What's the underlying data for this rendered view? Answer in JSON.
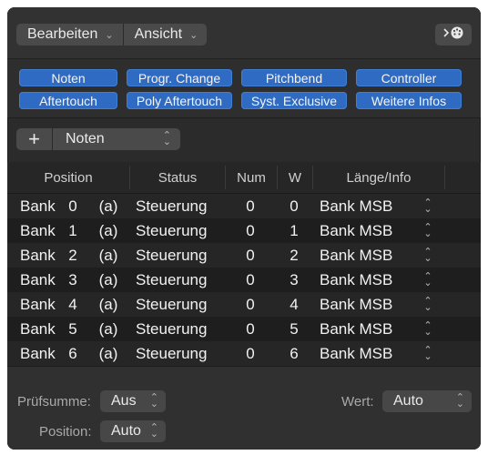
{
  "toolbar": {
    "menus": [
      {
        "label": "Bearbeiten"
      },
      {
        "label": "Ansicht"
      }
    ],
    "right_button_icon": "midi-view-icon"
  },
  "filters": {
    "row1": [
      "Noten",
      "Progr. Change",
      "Pitchbend",
      "Controller"
    ],
    "row2": [
      "Aftertouch",
      "Poly Aftertouch",
      "Syst. Exclusive",
      "Weitere Infos"
    ]
  },
  "add_bar": {
    "plus_label": "+",
    "type_value": "Noten"
  },
  "table": {
    "headers": {
      "position": "Position",
      "status": "Status",
      "num": "Num",
      "w": "W",
      "length": "Länge/Info"
    },
    "rows": [
      {
        "pos_label": "Bank",
        "pos_num": "0",
        "pos_suffix": "(a)",
        "status": "Steuerung",
        "num": "0",
        "w": "0",
        "info": "Bank MSB"
      },
      {
        "pos_label": "Bank",
        "pos_num": "1",
        "pos_suffix": "(a)",
        "status": "Steuerung",
        "num": "0",
        "w": "1",
        "info": "Bank MSB"
      },
      {
        "pos_label": "Bank",
        "pos_num": "2",
        "pos_suffix": "(a)",
        "status": "Steuerung",
        "num": "0",
        "w": "2",
        "info": "Bank MSB"
      },
      {
        "pos_label": "Bank",
        "pos_num": "3",
        "pos_suffix": "(a)",
        "status": "Steuerung",
        "num": "0",
        "w": "3",
        "info": "Bank MSB"
      },
      {
        "pos_label": "Bank",
        "pos_num": "4",
        "pos_suffix": "(a)",
        "status": "Steuerung",
        "num": "0",
        "w": "4",
        "info": "Bank MSB"
      },
      {
        "pos_label": "Bank",
        "pos_num": "5",
        "pos_suffix": "(a)",
        "status": "Steuerung",
        "num": "0",
        "w": "5",
        "info": "Bank MSB"
      },
      {
        "pos_label": "Bank",
        "pos_num": "6",
        "pos_suffix": "(a)",
        "status": "Steuerung",
        "num": "0",
        "w": "6",
        "info": "Bank MSB"
      }
    ]
  },
  "footer": {
    "checksum_label": "Prüfsumme:",
    "checksum_value": "Aus",
    "value_label": "Wert:",
    "value_value": "Auto",
    "position_label": "Position:",
    "position_value": "Auto"
  },
  "colors": {
    "panel_bg": "#2b2b2b",
    "filter_blue": "#2f6bc2",
    "row_odd": "#262626",
    "row_even": "#1e1e1e"
  }
}
